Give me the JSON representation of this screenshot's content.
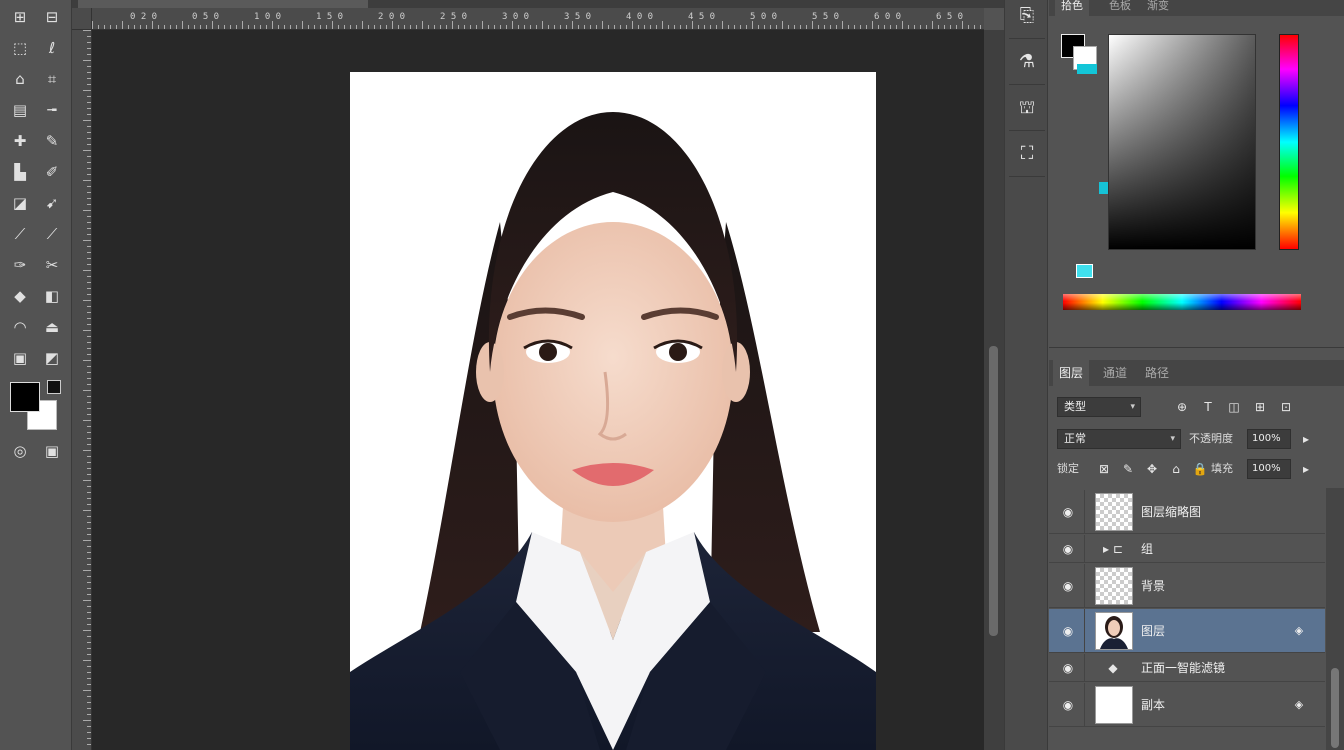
{
  "document": {
    "subject": "ID-photo portrait: woman with long dark hair, navy blazer over white collared shirt, white background"
  },
  "toolbar": {
    "tools": [
      {
        "name": "move-tool",
        "glyph": "⊞"
      },
      {
        "name": "artboard-tool",
        "glyph": "⊟"
      },
      {
        "name": "marquee-tool",
        "glyph": "⬚"
      },
      {
        "name": "lasso-tool",
        "glyph": "ℓ"
      },
      {
        "name": "quick-select-tool",
        "glyph": "⌂"
      },
      {
        "name": "crop-tool",
        "glyph": "⌗"
      },
      {
        "name": "frame-tool",
        "glyph": "▤"
      },
      {
        "name": "eyedropper-tool",
        "glyph": "╼"
      },
      {
        "name": "healing-tool",
        "glyph": "✚"
      },
      {
        "name": "brush-tool",
        "glyph": "✎"
      },
      {
        "name": "stamp-tool",
        "glyph": "▙"
      },
      {
        "name": "history-brush-tool",
        "glyph": "✐"
      },
      {
        "name": "eraser-tool",
        "glyph": "◪"
      },
      {
        "name": "gradient-tool",
        "glyph": "➹"
      },
      {
        "name": "blur-tool",
        "glyph": "⟋"
      },
      {
        "name": "dodge-tool",
        "glyph": "⟋"
      },
      {
        "name": "pen-tool",
        "glyph": "✑"
      },
      {
        "name": "type-tool",
        "glyph": "✂"
      },
      {
        "name": "path-select-tool",
        "glyph": "◆"
      },
      {
        "name": "shape-tool",
        "glyph": "◧"
      },
      {
        "name": "hand-tool",
        "glyph": "◠"
      },
      {
        "name": "zoom-tool",
        "glyph": "⏏"
      },
      {
        "name": "edit-toolbar",
        "glyph": "▣"
      },
      {
        "name": "extra-tool",
        "glyph": "◩"
      }
    ],
    "bottom": [
      {
        "name": "quick-mask-button",
        "glyph": "◎"
      },
      {
        "name": "screen-mode-button",
        "glyph": "▣"
      }
    ]
  },
  "ruler": {
    "labels": [
      "0 2 0",
      "0 5 0",
      "1 0 0",
      "1 5 0",
      "2 0 0",
      "2 5 0",
      "3 0 0",
      "3 5 0",
      "4 0 0",
      "4 5 0",
      "5 0 0",
      "5 5 0",
      "6 0 0",
      "6 5 0"
    ]
  },
  "dock": {
    "buttons": [
      {
        "name": "history-panel-button",
        "glyph": "⎘"
      },
      {
        "name": "adjustments-panel-button",
        "glyph": "⚗"
      },
      {
        "name": "libraries-panel-button",
        "glyph": "⛫"
      },
      {
        "name": "properties-panel-button",
        "glyph": "⛶"
      }
    ]
  },
  "color_panel": {
    "tabs": [
      "拾色",
      "色板",
      "渐变"
    ],
    "foreground": "#000000",
    "background": "#ffffff",
    "accent": "#13c6d8"
  },
  "layers_panel": {
    "tabs": [
      "图层",
      "通道",
      "路径"
    ],
    "filter_kind": "类型",
    "blend_mode": "正常",
    "opacity_label": "不透明度",
    "opacity_value": "100%",
    "lock_label": "锁定",
    "fill_label": "填充",
    "fill_value": "100%",
    "filter_icons": [
      "⊕",
      "T",
      "◫",
      "⊞",
      "⊡"
    ],
    "lock_icons": [
      "⊠",
      "✎",
      "✥",
      "⌂",
      "🔒"
    ],
    "layers": [
      {
        "name": "图层缩略图",
        "type": "checker",
        "selected": false,
        "thin": false
      },
      {
        "name": "组",
        "type": "group",
        "selected": false,
        "thin": true
      },
      {
        "name": "背景",
        "type": "checker",
        "selected": false,
        "thin": false
      },
      {
        "name": "图层",
        "type": "photo",
        "selected": true,
        "thin": false
      },
      {
        "name": "正面一智能滤镜",
        "type": "effect",
        "selected": false,
        "thin": true
      },
      {
        "name": "副本",
        "type": "white",
        "selected": false,
        "thin": false
      }
    ]
  }
}
